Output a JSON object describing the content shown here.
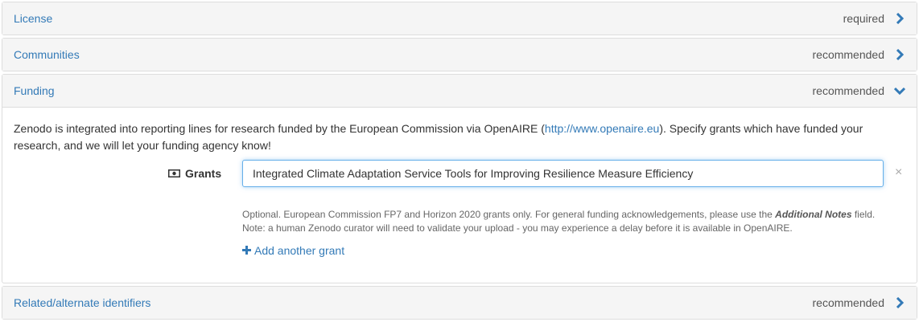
{
  "panels": {
    "license": {
      "title": "License",
      "status": "required"
    },
    "communities": {
      "title": "Communities",
      "status": "recommended"
    },
    "funding": {
      "title": "Funding",
      "status": "recommended",
      "intro_before": "Zenodo is integrated into reporting lines for research funded by the European Commission via OpenAIRE (",
      "intro_link": "http://www.openaire.eu",
      "intro_after": "). Specify grants which have funded your research, and we will let your funding agency know!",
      "grants_label": "Grants",
      "grants_value": "Integrated Climate Adaptation Service Tools for Improving Resilience Measure Efficiency",
      "remove_symbol": "×",
      "help_line1_before": "Optional. European Commission FP7 and Horizon 2020 grants only. For general funding acknowledgements, please use the ",
      "help_line1_em": "Additional Notes",
      "help_line1_after": " field.",
      "help_line2": "Note: a human Zenodo curator will need to validate your upload - you may experience a delay before it is available in OpenAIRE.",
      "add_grant_label": "Add another grant"
    },
    "related": {
      "title": "Related/alternate identifiers",
      "status": "recommended"
    }
  },
  "icons": {
    "chevron_right": "chevron-right-icon",
    "chevron_down": "chevron-down-icon",
    "grants": "money-icon",
    "add": "plus-icon",
    "remove": "close-icon"
  },
  "colors": {
    "link": "#337ab7",
    "panel_heading_bg": "#f5f5f5",
    "border": "#dddddd",
    "input_focus": "#66afe9"
  }
}
